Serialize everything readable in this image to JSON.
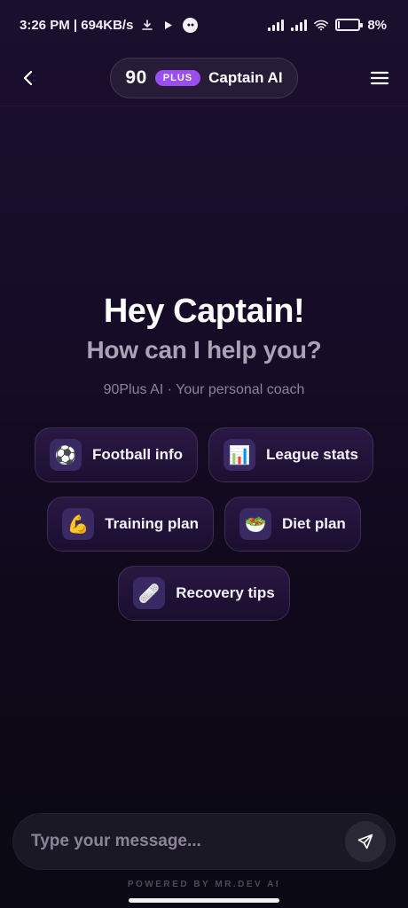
{
  "status_bar": {
    "time": "3:26 PM | 694KB/s",
    "battery_text": "8%",
    "battery_level": 0.08,
    "icons": [
      "download-icon",
      "play-icon",
      "app-badge-icon",
      "signal-icon",
      "signal-icon",
      "wifi-icon",
      "battery-charging-icon"
    ]
  },
  "header": {
    "brand_number": "90",
    "plus_badge": "PLUS",
    "title": "Captain AI",
    "back_icon": "back-chevron-icon",
    "menu_icon": "hamburger-menu-icon"
  },
  "hero": {
    "greeting": "Hey Captain!",
    "question": "How can I help you?",
    "subtitle": "90Plus AI · Your personal coach"
  },
  "suggestions": [
    {
      "label": "Football info",
      "icon": "⚽"
    },
    {
      "label": "League stats",
      "icon": "📊"
    },
    {
      "label": "Training plan",
      "icon": "💪"
    },
    {
      "label": "Diet plan",
      "icon": "🥗"
    },
    {
      "label": "Recovery tips",
      "icon": "🩹"
    }
  ],
  "composer": {
    "placeholder": "Type your message...",
    "value": "",
    "send_icon": "send-icon"
  },
  "footer": {
    "powered_by": "POWERED BY MR.DEV AI"
  },
  "colors": {
    "accent": "#9b4ef0",
    "background": "#1b0f2e",
    "chip_icon_bg": "#3a2a63"
  }
}
